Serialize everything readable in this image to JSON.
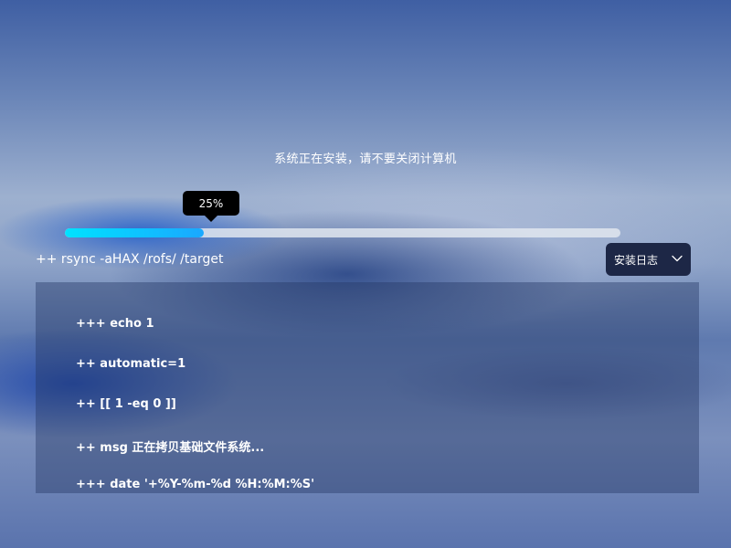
{
  "status": {
    "message": "系统正在安装，请不要关闭计算机"
  },
  "progress": {
    "percent": 25,
    "label": "25%",
    "fill_color_start": "#00e2ff",
    "fill_color_end": "#1aa8ff"
  },
  "current_command": "++ rsync -aHAX /rofs/ /target",
  "log_toggle": {
    "label": "安装日志",
    "icon": "chevron-down-icon"
  },
  "log": {
    "lines": [
      "+++ echo 1",
      "++ automatic=1",
      "++ [[ 1 -eq 0 ]]",
      "++ msg 正在拷贝基础文件系统...",
      "+++ date '+%Y-%m-%d %H:%M:%S'"
    ]
  }
}
